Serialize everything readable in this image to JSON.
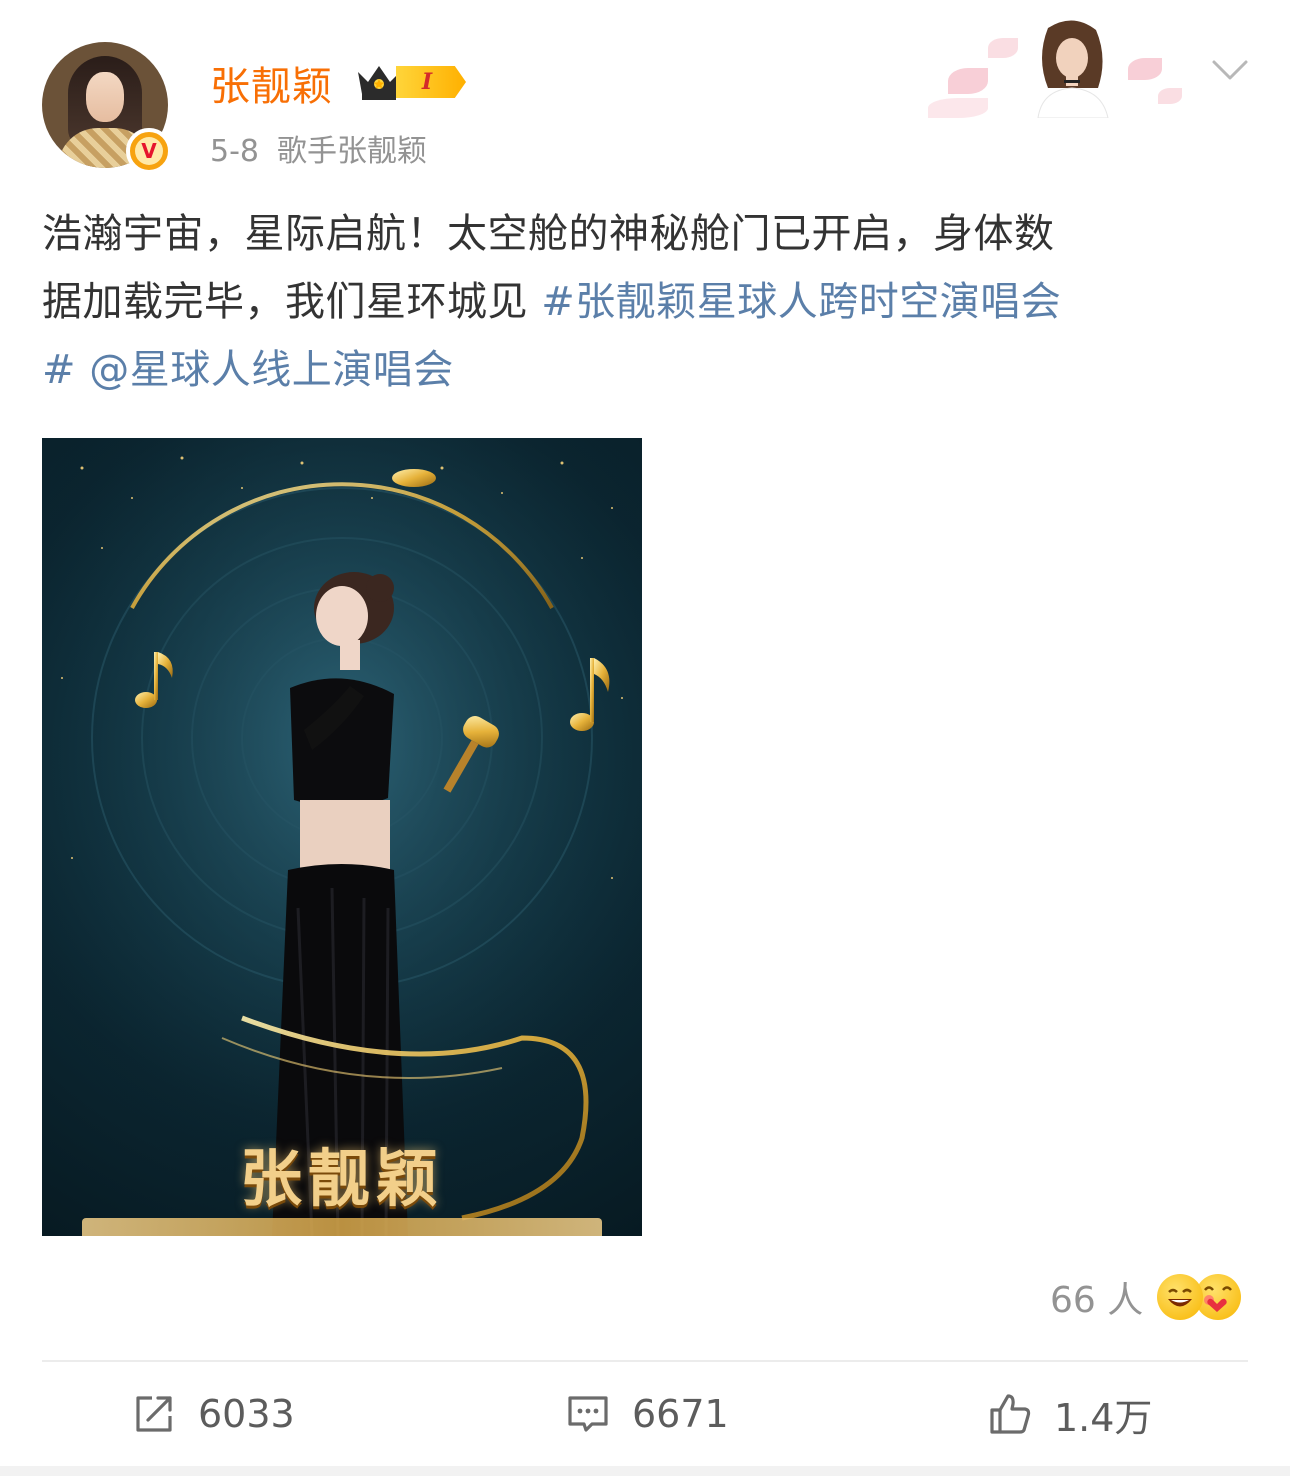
{
  "post": {
    "author": "张靓颖",
    "vip_level": "I",
    "date": "5-8",
    "source": "歌手张靓颖",
    "verified_badge": "V",
    "text_lines": [
      "浩瀚宇宙，星际启航！太空舱的神秘舱门已开启，身体数",
      "据加载完毕，我们星环城见 "
    ],
    "hashtag_part1": "#张靓颖星球人跨时空演唱会",
    "hashtag_part2": "#",
    "mention": " @星球人线上演唱会",
    "poster_title": "张靓颖"
  },
  "reactions": {
    "count_label": "66 人",
    "icons": [
      "laugh-emoji",
      "love-emoji"
    ]
  },
  "actions": {
    "repost_count": "6033",
    "comment_count": "6671",
    "like_count": "1.4万"
  },
  "colors": {
    "username": "#f86f05",
    "link": "#5b7fa9",
    "meta": "#939393",
    "text": "#333333"
  }
}
